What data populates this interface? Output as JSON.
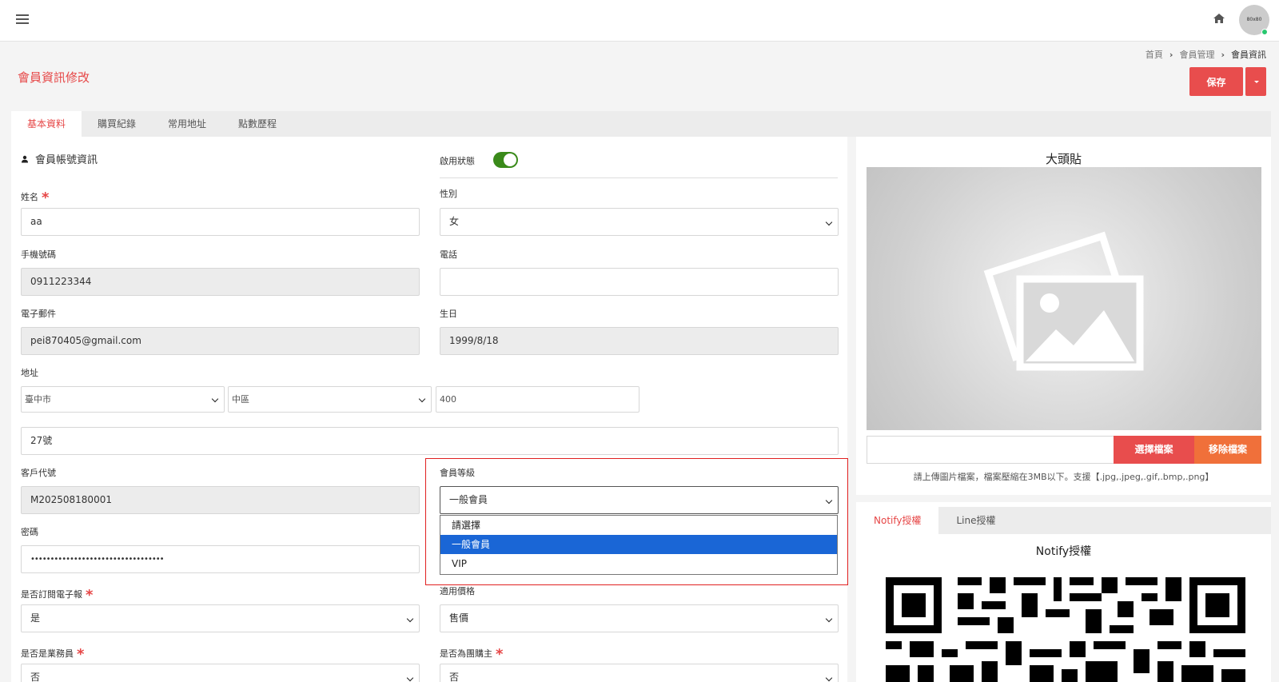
{
  "topbar": {
    "menu_icon": "hamburger-icon",
    "home_icon": "home-icon",
    "avatar_text": "80x80"
  },
  "breadcrumb": [
    "首頁",
    "會員管理",
    "會員資訊"
  ],
  "page": {
    "title": "會員資訊修改",
    "save_label": "保存"
  },
  "tabs": [
    "基本資料",
    "購買紀錄",
    "常用地址",
    "點數歷程"
  ],
  "account_section": {
    "title": "會員帳號資訊",
    "toggle_label": "啟用狀態",
    "toggle_on": true
  },
  "form": {
    "name": {
      "label": "姓名",
      "value": "aa"
    },
    "gender": {
      "label": "性別",
      "value": "女"
    },
    "mobile": {
      "label": "手機號碼",
      "value": "0911223344"
    },
    "phone": {
      "label": "電話",
      "value": ""
    },
    "email": {
      "label": "電子郵件",
      "value": "pei870405@gmail.com"
    },
    "birthday": {
      "label": "生日",
      "value": "1999/8/18"
    },
    "address": {
      "label": "地址",
      "city": "臺中市",
      "district": "中區",
      "zip": "400",
      "street": "27號"
    },
    "customer_code": {
      "label": "客戶代號",
      "value": "M202508180001"
    },
    "member_level": {
      "label": "會員等級",
      "value": "一般會員",
      "options": [
        "請選擇",
        "一般會員",
        "VIP"
      ]
    },
    "password": {
      "label": "密碼",
      "value": "••••••••••••••••••••••••••••••••••"
    },
    "newsletter": {
      "label": "是否訂閱電子報",
      "value": "是"
    },
    "price_type": {
      "label": "適用價格",
      "value": "售價"
    },
    "is_sales": {
      "label": "是否是業務員",
      "value": "否"
    },
    "is_group_leader": {
      "label": "是否為團購主",
      "value": "否"
    }
  },
  "avatar_panel": {
    "title": "大頭貼",
    "choose_label": "選擇檔案",
    "remove_label": "移除檔案",
    "hint": "請上傳圖片檔案，檔案壓縮在3MB以下。支援【.jpg,.jpeg,.gif,.bmp,.png】"
  },
  "auth_panel": {
    "tabs": [
      "Notify授權",
      "Line授權"
    ],
    "title": "Notify授權"
  },
  "colors": {
    "accent": "#e84d4d",
    "remove": "#f0703a",
    "toggle": "#3a8a1a",
    "highlight": "#e02020",
    "selected": "#1a66d6"
  }
}
